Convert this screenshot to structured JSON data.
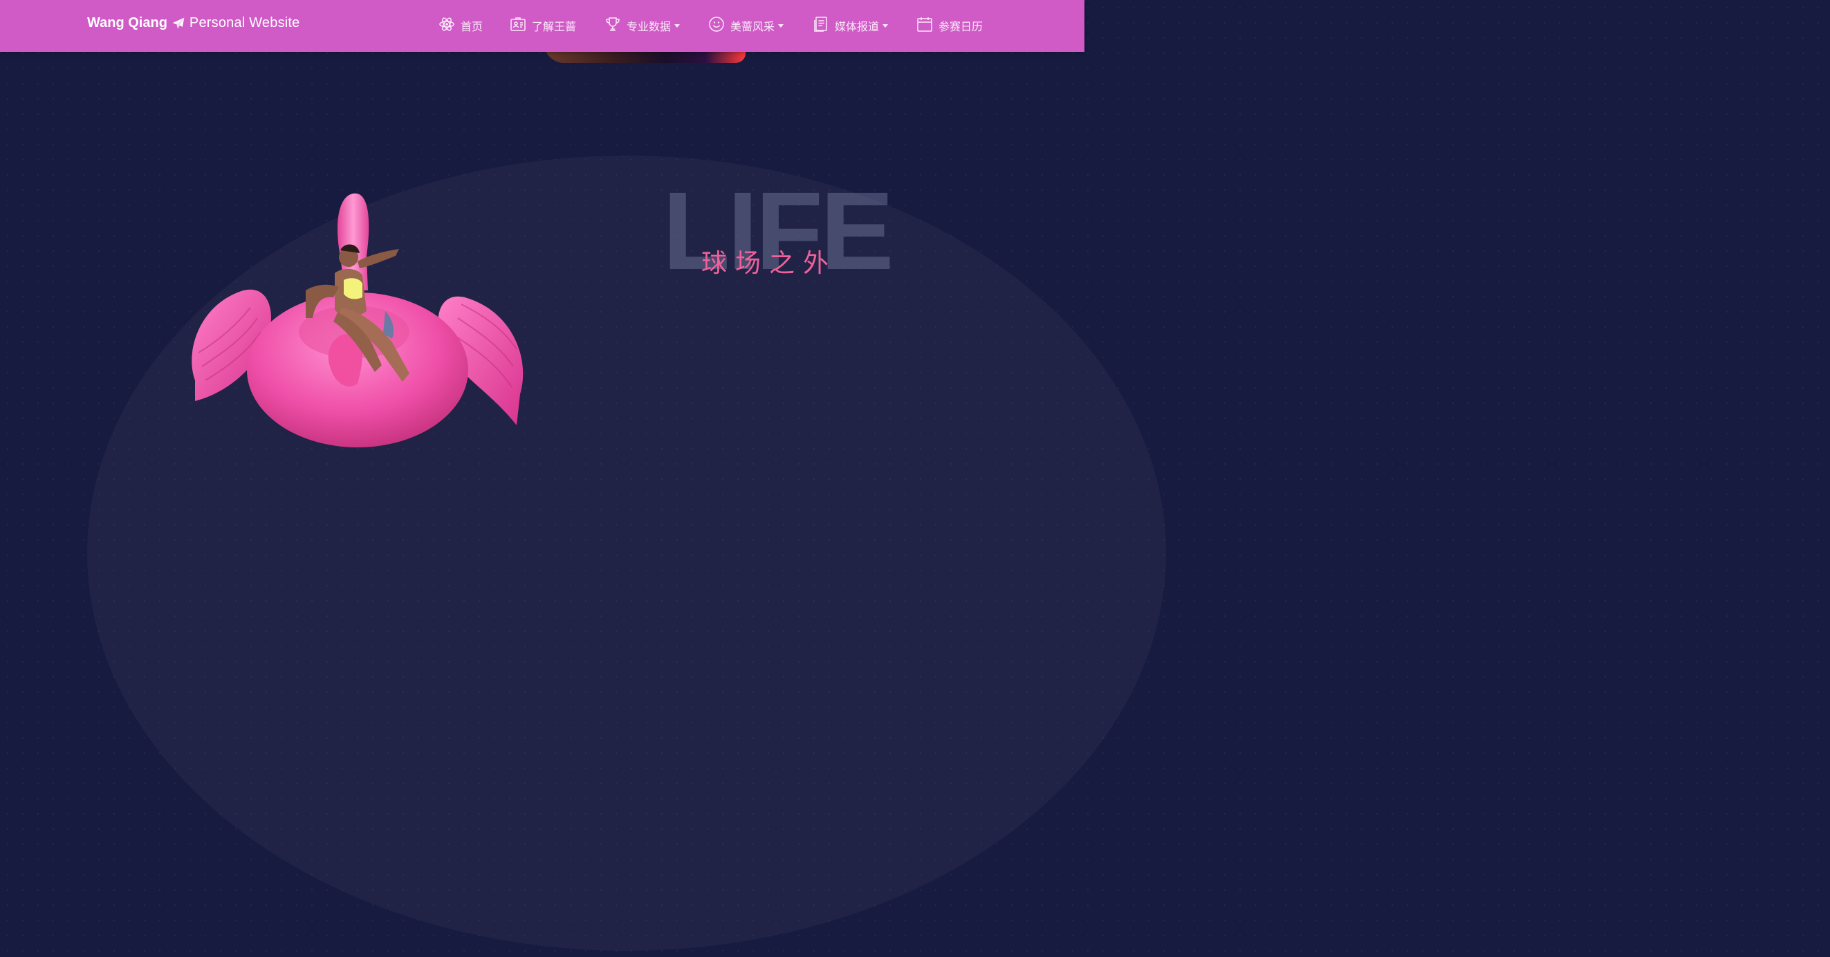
{
  "brand": {
    "name_bold": "Wang Qiang",
    "name_light": "Personal Website",
    "icon": "paper-plane-icon"
  },
  "nav": {
    "items": [
      {
        "label": "首页",
        "icon": "atom-icon",
        "dropdown": false
      },
      {
        "label": "了解王蔷",
        "icon": "id-card-icon",
        "dropdown": false
      },
      {
        "label": "专业数据",
        "icon": "trophy-icon",
        "dropdown": true
      },
      {
        "label": "美蔷风采",
        "icon": "smile-icon",
        "dropdown": true
      },
      {
        "label": "媒体报道",
        "icon": "document-icon",
        "dropdown": true
      },
      {
        "label": "参赛日历",
        "icon": "calendar-icon",
        "dropdown": false
      }
    ]
  },
  "section": {
    "watermark": "LIFE",
    "subtitle": "球场之外"
  },
  "colors": {
    "navbar": "#d05bc7",
    "background": "#181b40",
    "accent": "#f0609a"
  }
}
